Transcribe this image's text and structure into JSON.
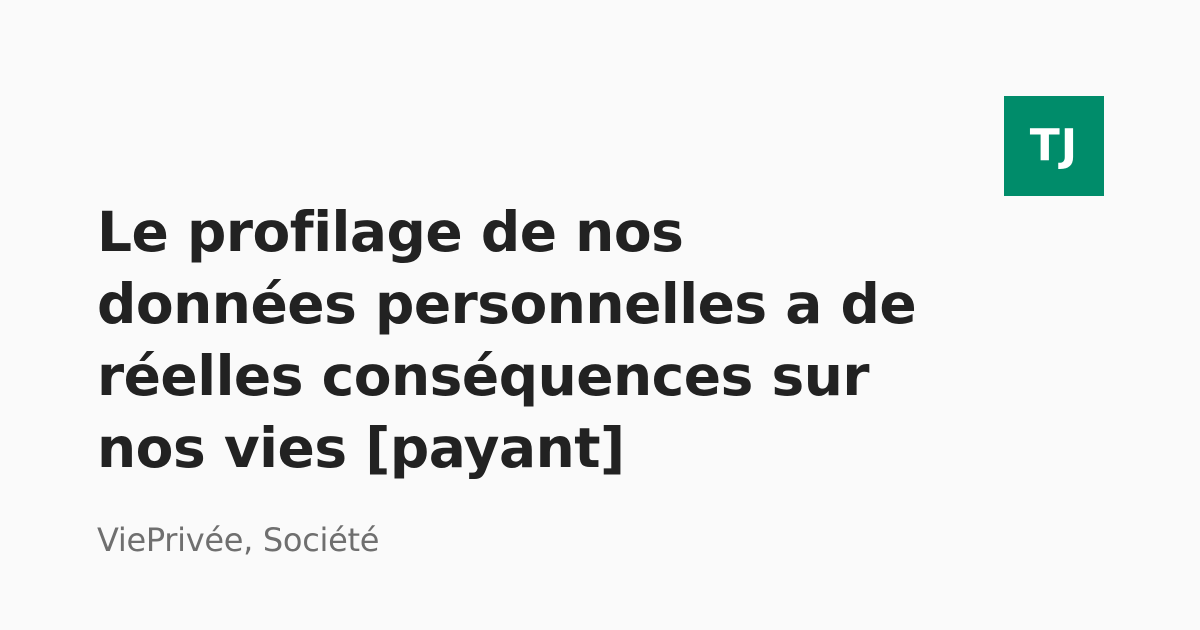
{
  "logo": {
    "text": "TJ",
    "background_color": "#008c6a",
    "text_color": "#ffffff"
  },
  "article": {
    "title": "Le profilage de nos données personnelles a de réelles conséquences sur nos vies [payant]",
    "tags": "ViePrivée, Société"
  },
  "colors": {
    "background": "#fafafa",
    "title": "#222222",
    "tags": "#6f6f6f"
  }
}
